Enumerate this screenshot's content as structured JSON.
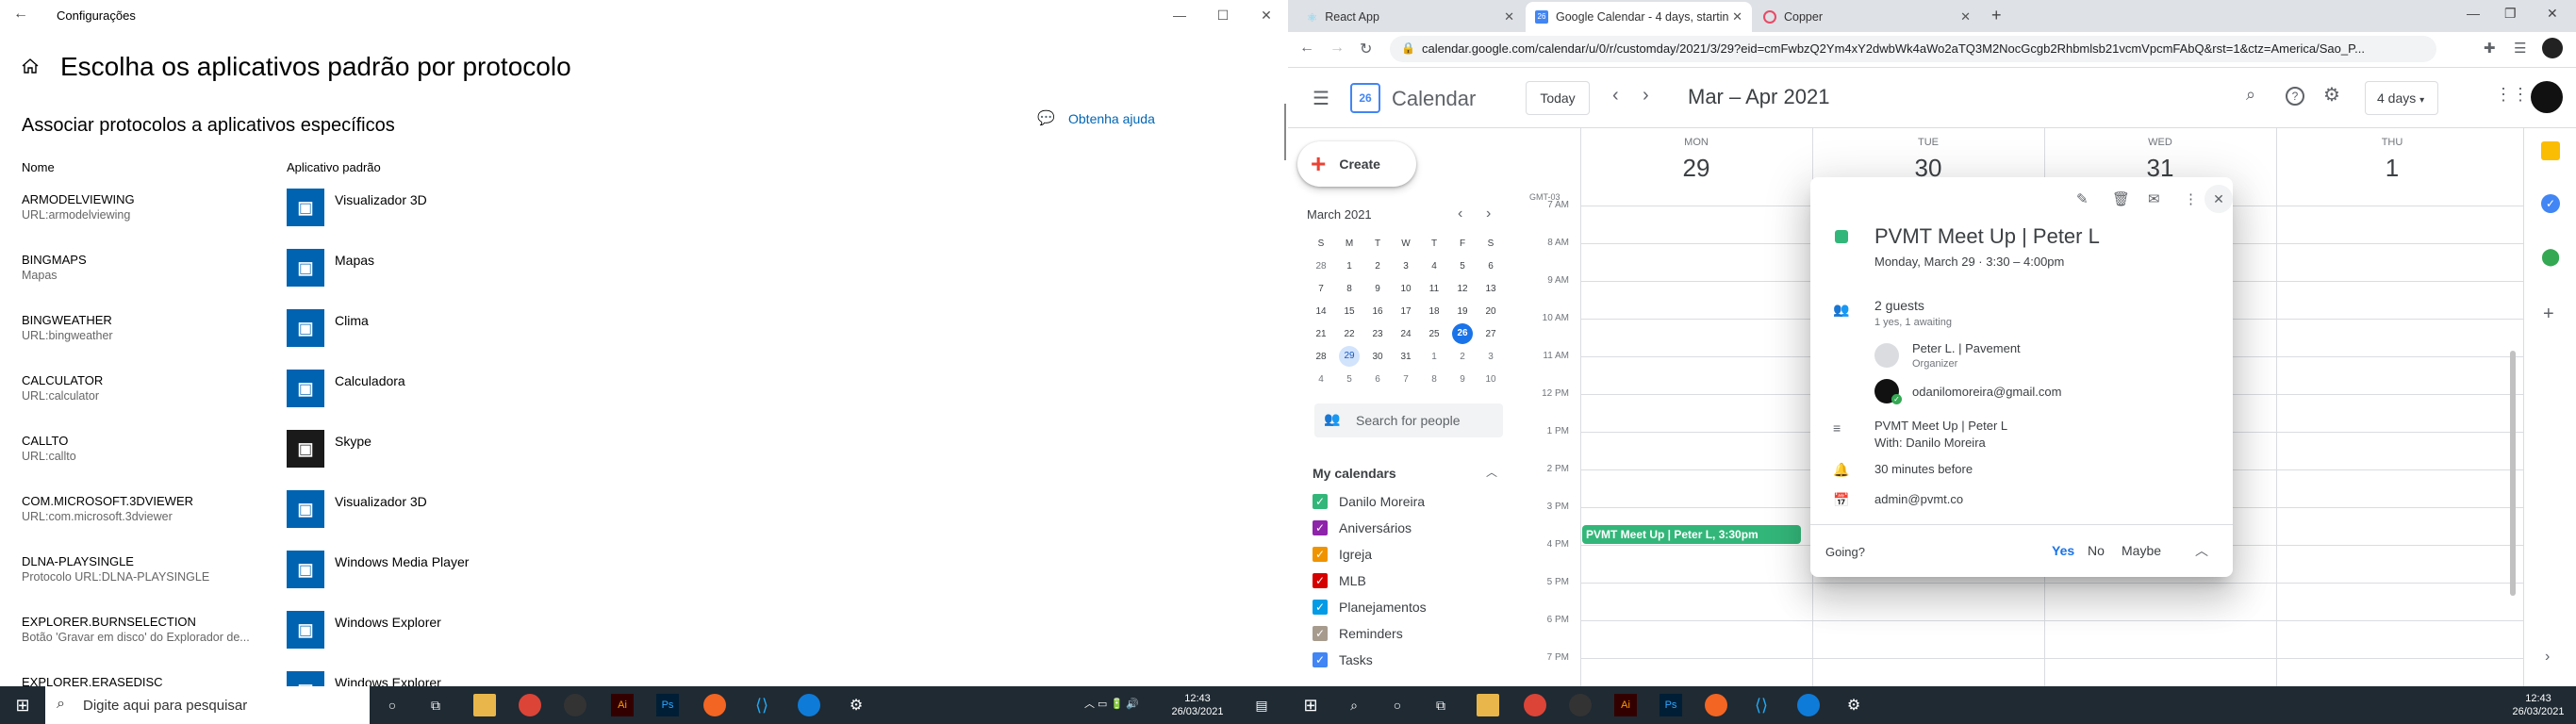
{
  "settings": {
    "window_title": "Configurações",
    "heading": "Escolha os aplicativos padrão por protocolo",
    "subheading": "Associar protocolos a aplicativos específicos",
    "help_link": "Obtenha ajuda",
    "col_name": "Nome",
    "col_app": "Aplicativo padrão",
    "rows": [
      {
        "name": "ARMODELVIEWING",
        "desc": "URL:armodelviewing",
        "app": "Visualizador 3D",
        "icon": "cube-3d-icon",
        "color": "#0063b1"
      },
      {
        "name": "BINGMAPS",
        "desc": "Mapas",
        "app": "Mapas",
        "icon": "map-pin-icon",
        "color": "#0063b1"
      },
      {
        "name": "BINGWEATHER",
        "desc": "URL:bingweather",
        "app": "Clima",
        "icon": "weather-icon",
        "color": "#0063b1"
      },
      {
        "name": "CALCULATOR",
        "desc": "URL:calculator",
        "app": "Calculadora",
        "icon": "calculator-icon",
        "color": "#0063b1"
      },
      {
        "name": "CALLTO",
        "desc": "URL:callto",
        "app": "Skype",
        "icon": "skype-icon",
        "color": "#1a1a1a"
      },
      {
        "name": "COM.MICROSOFT.3DVIEWER",
        "desc": "URL:com.microsoft.3dviewer",
        "app": "Visualizador 3D",
        "icon": "cube-3d-icon",
        "color": "#0063b1"
      },
      {
        "name": "DLNA-PLAYSINGLE",
        "desc": "Protocolo URL:DLNA-PLAYSINGLE",
        "app": "Windows Media Player",
        "icon": "media-player-icon",
        "color": "#0063b1"
      },
      {
        "name": "EXPLORER.BURNSELECTION",
        "desc": "Botão 'Gravar em disco' do Explorador de...",
        "app": "Windows Explorer",
        "icon": "folder-icon",
        "color": "#0063b1"
      },
      {
        "name": "EXPLORER.ERASEDISC",
        "desc": "",
        "app": "Windows Explorer",
        "icon": "folder-icon",
        "color": "#0063b1"
      }
    ]
  },
  "browser": {
    "tabs": [
      {
        "label": "React App"
      },
      {
        "label": "Google Calendar - 4 days, startin"
      },
      {
        "label": "Copper"
      }
    ],
    "url": "calendar.google.com/calendar/u/0/r/customday/2021/3/29?eid=cmFwbzQ2Ym4xY2dwbWk4aWo2aTQ3M2NocGcgb2Rhbmlsb21vcmVpcmFAbQ&rst=1&ctz=America/Sao_P..."
  },
  "calendar": {
    "app_name": "Calendar",
    "today_btn": "Today",
    "range": "Mar – Apr 2021",
    "view": "4 days",
    "create": "Create",
    "mini_month": "March 2021",
    "weekdays": [
      "S",
      "M",
      "T",
      "W",
      "T",
      "F",
      "S"
    ],
    "weeks": [
      [
        "28",
        "1",
        "2",
        "3",
        "4",
        "5",
        "6"
      ],
      [
        "7",
        "8",
        "9",
        "10",
        "11",
        "12",
        "13"
      ],
      [
        "14",
        "15",
        "16",
        "17",
        "18",
        "19",
        "20"
      ],
      [
        "21",
        "22",
        "23",
        "24",
        "25",
        "26",
        "27"
      ],
      [
        "28",
        "29",
        "30",
        "31",
        "1",
        "2",
        "3"
      ],
      [
        "4",
        "5",
        "6",
        "7",
        "8",
        "9",
        "10"
      ]
    ],
    "search_people": "Search for people",
    "my_calendars": "My calendars",
    "calendars": [
      {
        "name": "Danilo Moreira",
        "color": "#33b679"
      },
      {
        "name": "Aniversários",
        "color": "#8e24aa"
      },
      {
        "name": "Igreja",
        "color": "#f09300"
      },
      {
        "name": "MLB",
        "color": "#d50000"
      },
      {
        "name": "Planejamentos",
        "color": "#039be5"
      },
      {
        "name": "Reminders",
        "color": "#a79b8e"
      },
      {
        "name": "Tasks",
        "color": "#4285f4"
      }
    ],
    "tz": "GMT-03",
    "times": [
      "7 AM",
      "8 AM",
      "9 AM",
      "10 AM",
      "11 AM",
      "12 PM",
      "1 PM",
      "2 PM",
      "3 PM",
      "4 PM",
      "5 PM",
      "6 PM",
      "7 PM"
    ],
    "days": [
      {
        "name": "MON",
        "num": "29"
      },
      {
        "name": "TUE",
        "num": "30"
      },
      {
        "name": "WED",
        "num": "31"
      },
      {
        "name": "THU",
        "num": "1"
      }
    ],
    "event_label": "PVMT Meet Up | Peter L, 3:30pm",
    "popup": {
      "title": "PVMT Meet Up | Peter L",
      "when": "Monday, March 29  ·  3:30 – 4:00pm",
      "guests": "2 guests",
      "guests_sub": "1 yes, 1 awaiting",
      "guest1": "Peter L. | Pavement",
      "guest1_role": "Organizer",
      "guest2": "odanilomoreira@gmail.com",
      "desc1": "PVMT Meet Up | Peter L",
      "desc2": "With: Danilo Moreira",
      "reminder": "30 minutes before",
      "calendar_owner": "admin@pvmt.co",
      "going": "Going?",
      "yes": "Yes",
      "no": "No",
      "maybe": "Maybe"
    }
  },
  "taskbar": {
    "search_placeholder": "Digite aqui para pesquisar",
    "time": "12:43",
    "date": "26/03/2021"
  }
}
